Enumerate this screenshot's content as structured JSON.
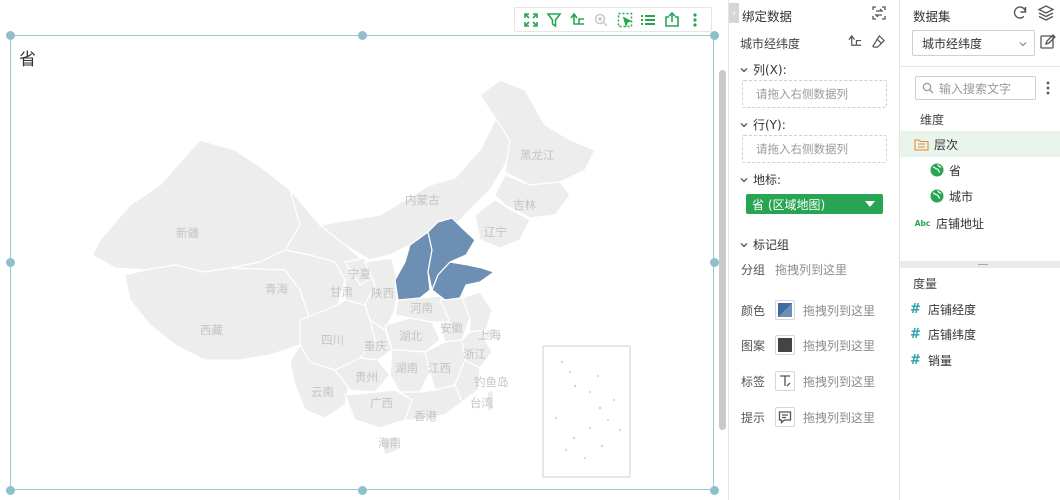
{
  "chart": {
    "title": "省",
    "provinces": [
      {
        "name": "新疆"
      },
      {
        "name": "西藏"
      },
      {
        "name": "青海"
      },
      {
        "name": "甘肃"
      },
      {
        "name": "宁夏"
      },
      {
        "name": "内蒙古"
      },
      {
        "name": "黑龙江"
      },
      {
        "name": "吉林"
      },
      {
        "name": "辽宁"
      },
      {
        "name": "陕西"
      },
      {
        "name": "河南"
      },
      {
        "name": "安徽"
      },
      {
        "name": "湖北"
      },
      {
        "name": "四川"
      },
      {
        "name": "重庆"
      },
      {
        "name": "贵州"
      },
      {
        "name": "湖南"
      },
      {
        "name": "江西"
      },
      {
        "name": "浙江"
      },
      {
        "name": "上海"
      },
      {
        "name": "云南"
      },
      {
        "name": "广西"
      },
      {
        "name": "钓鱼岛"
      },
      {
        "name": "台湾"
      },
      {
        "name": "香港"
      },
      {
        "name": "海南"
      }
    ],
    "highlight_color": "#6d8fb3",
    "base_color": "#ededed"
  },
  "bind_panel": {
    "title": "绑定数据",
    "dataset_label": "城市经纬度",
    "columns_label": "列(X):",
    "columns_placeholder": "请拖入右侧数据列",
    "rows_label": "行(Y):",
    "rows_placeholder": "请拖入右侧数据列",
    "geo_label": "地标:",
    "geo_field": "省 (区域地图)",
    "marks_label": "标记组",
    "group_label": "分组",
    "group_hint": "拖拽列到这里",
    "marks": [
      {
        "label": "颜色",
        "hint": "拖拽列到这里"
      },
      {
        "label": "图案",
        "hint": "拖拽列到这里"
      },
      {
        "label": "标签",
        "hint": "拖拽列到这里"
      },
      {
        "label": "提示",
        "hint": "拖拽列到这里"
      }
    ]
  },
  "data_panel": {
    "title": "数据集",
    "selected_dataset": "城市经纬度",
    "search_placeholder": "输入搜索文字",
    "dimensions_label": "维度",
    "hierarchy": "层次",
    "hierarchy_children": [
      "省",
      "城市"
    ],
    "text_field": "店铺地址",
    "text_field_type": "Abc",
    "measures_label": "度量",
    "measures": [
      "店铺经度",
      "店铺纬度",
      "销量"
    ]
  }
}
